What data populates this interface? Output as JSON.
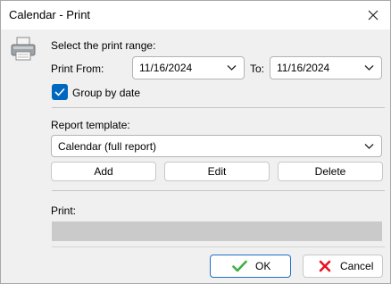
{
  "window": {
    "title": "Calendar - Print"
  },
  "range": {
    "heading": "Select the print range:",
    "from_label": "Print From:",
    "from_value": "11/16/2024",
    "to_label": "To:",
    "to_value": "11/16/2024"
  },
  "group_by_date": {
    "label": "Group by date",
    "checked": true
  },
  "template": {
    "label": "Report template:",
    "value": "Calendar (full report)",
    "add_label": "Add",
    "edit_label": "Edit",
    "delete_label": "Delete"
  },
  "print": {
    "label": "Print:",
    "progress": 0
  },
  "footer": {
    "ok_label": "OK",
    "cancel_label": "Cancel"
  },
  "colors": {
    "accent": "#0067c0",
    "ok_icon": "#3cb043",
    "cancel_icon": "#e81123",
    "progress_track": "#cacaca"
  },
  "icons": {
    "window": "printer-icon",
    "close": "close-icon",
    "ok": "checkmark-icon",
    "cancel": "x-icon"
  }
}
